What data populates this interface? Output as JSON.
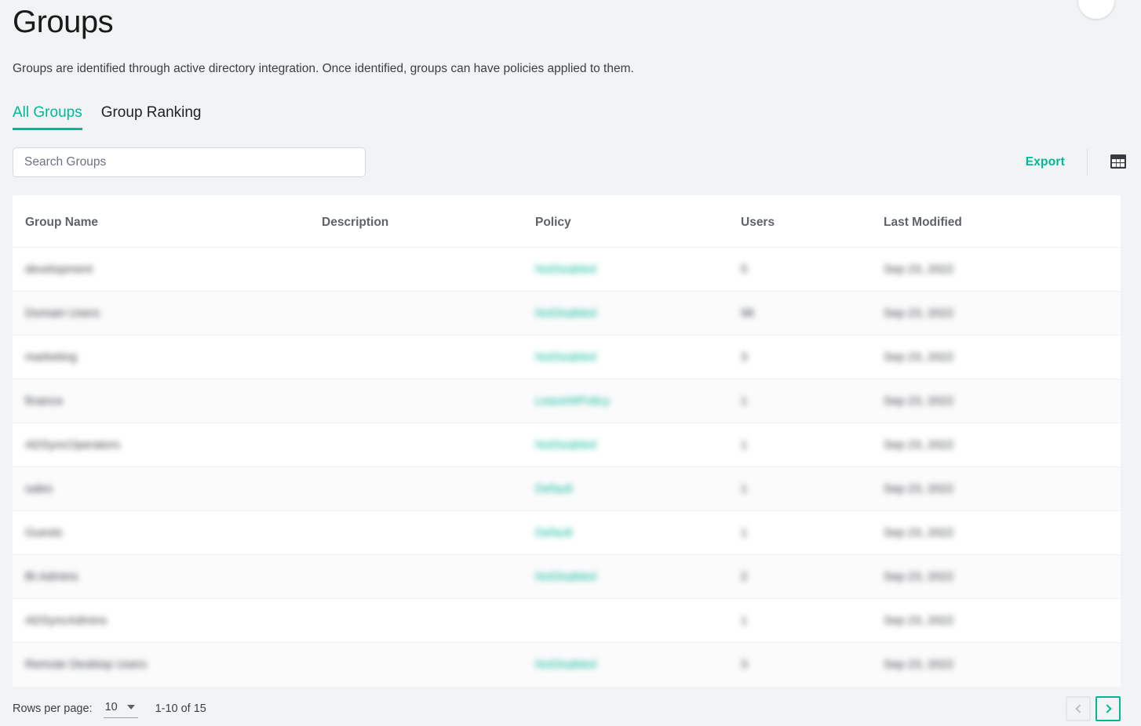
{
  "page": {
    "title": "Groups",
    "subtitle": "Groups are identified through active directory integration. Once identified, groups can have policies applied to them."
  },
  "avatar": {
    "name": "user-avatar"
  },
  "tabs": [
    {
      "label": "All Groups",
      "active": true
    },
    {
      "label": "Group Ranking",
      "active": false
    }
  ],
  "toolbar": {
    "search_placeholder": "Search Groups",
    "search_value": "",
    "export_label": "Export",
    "grid_icon": "table-grid-icon"
  },
  "table": {
    "columns": [
      "Group Name",
      "Description",
      "Policy",
      "Users",
      "Last Modified"
    ],
    "rows": [
      {
        "name": "development",
        "description": "",
        "policy": "NoDisabled",
        "users": "5",
        "modified": "Sep 23, 2022"
      },
      {
        "name": "Domain Users",
        "description": "",
        "policy": "NoDisabled",
        "users": "98",
        "modified": "Sep 23, 2022"
      },
      {
        "name": "marketing",
        "description": "",
        "policy": "NoDisabled",
        "users": "3",
        "modified": "Sep 23, 2022"
      },
      {
        "name": "finance",
        "description": "",
        "policy": "LeaveWPolicy",
        "users": "1",
        "modified": "Sep 23, 2022"
      },
      {
        "name": "ADSyncOperators",
        "description": "",
        "policy": "NoDisabled",
        "users": "1",
        "modified": "Sep 23, 2022"
      },
      {
        "name": "sales",
        "description": "",
        "policy": "Default",
        "users": "1",
        "modified": "Sep 23, 2022"
      },
      {
        "name": "Guests",
        "description": "",
        "policy": "Default",
        "users": "1",
        "modified": "Sep 23, 2022"
      },
      {
        "name": "BI Admins",
        "description": "",
        "policy": "NoDisabled",
        "users": "2",
        "modified": "Sep 23, 2022"
      },
      {
        "name": "ADSyncAdmins",
        "description": "",
        "policy": "",
        "users": "1",
        "modified": "Sep 23, 2022"
      },
      {
        "name": "Remote Desktop Users",
        "description": "",
        "policy": "NoDisabled",
        "users": "3",
        "modified": "Sep 23, 2022"
      }
    ]
  },
  "footer": {
    "rows_per_page_label": "Rows per page:",
    "rows_per_page_value": "10",
    "range_label": "1-10 of 15",
    "prev_enabled": false,
    "next_enabled": true
  },
  "colors": {
    "accent": "#00b894",
    "page_background": "#f1f3f4",
    "card_background": "#ffffff",
    "header_text": "#5f6368",
    "body_text": "#3c4043"
  }
}
